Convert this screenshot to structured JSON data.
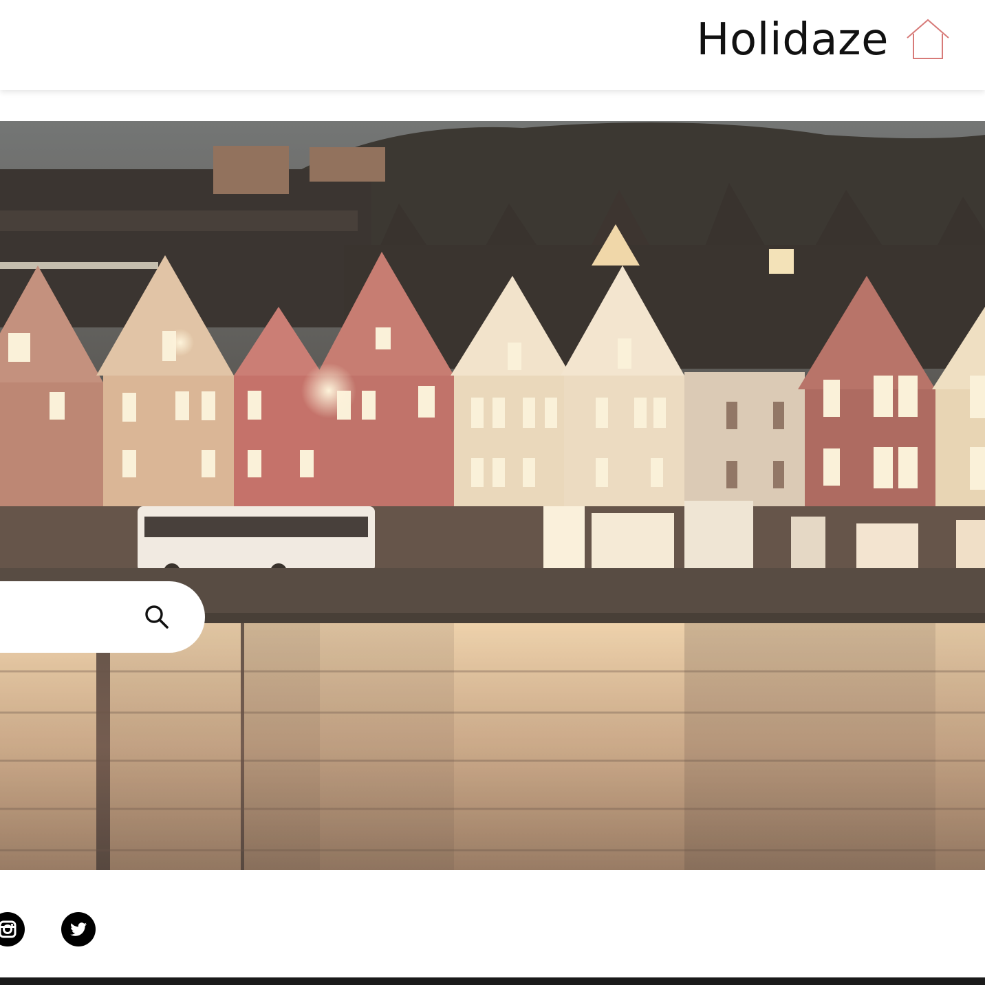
{
  "header": {
    "brand_name": "Holidaze",
    "brand_icon": "house-outline-icon",
    "accent_color": "#d77a78"
  },
  "hero": {
    "image_subject": "harbor-waterfront-night-photo"
  },
  "search": {
    "placeholder": "",
    "value": "",
    "icon": "search-icon"
  },
  "social": {
    "items": [
      {
        "icon": "instagram-icon"
      },
      {
        "icon": "twitter-icon"
      }
    ]
  }
}
